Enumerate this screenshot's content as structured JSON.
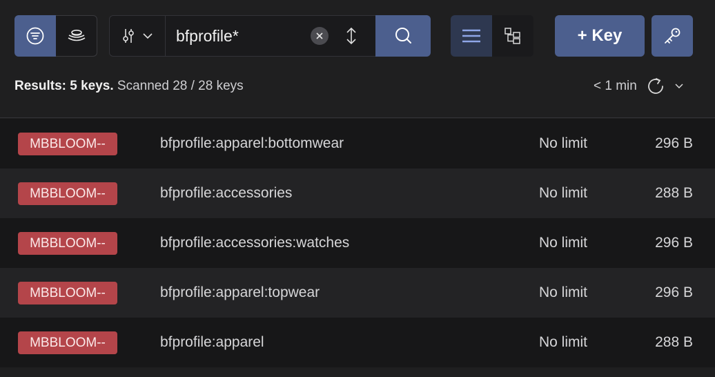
{
  "toolbar": {
    "filter_icon": "filter-icon",
    "stack_icon": "database-stack-icon",
    "filter_select_icon": "sliders-icon",
    "search": {
      "value": "bfprofile*",
      "placeholder": ""
    },
    "clear_icon": "close-icon",
    "sort_icon": "sort-icon",
    "search_icon": "search-icon",
    "list_view_icon": "list-view-icon",
    "tree_view_icon": "tree-view-icon",
    "add_key_label": "+ Key",
    "key_tool_icon": "key-icon",
    "accent_color": "#4c5f8e"
  },
  "status": {
    "results_label": "Results: 5 keys.",
    "scanned_label": "Scanned 28 / 28 keys",
    "refresh_time": "< 1 min",
    "refresh_icon": "refresh-icon",
    "dropdown_icon": "chevron-down-icon"
  },
  "keys": [
    {
      "type": "MBBLOOM--",
      "name": "bfprofile:apparel:bottomwear",
      "ttl": "No limit",
      "size": "296 B"
    },
    {
      "type": "MBBLOOM--",
      "name": "bfprofile:accessories",
      "ttl": "No limit",
      "size": "288 B"
    },
    {
      "type": "MBBLOOM--",
      "name": "bfprofile:accessories:watches",
      "ttl": "No limit",
      "size": "296 B"
    },
    {
      "type": "MBBLOOM--",
      "name": "bfprofile:apparel:topwear",
      "ttl": "No limit",
      "size": "296 B"
    },
    {
      "type": "MBBLOOM--",
      "name": "bfprofile:apparel",
      "ttl": "No limit",
      "size": "288 B"
    }
  ],
  "badge_color": "#b4454a"
}
